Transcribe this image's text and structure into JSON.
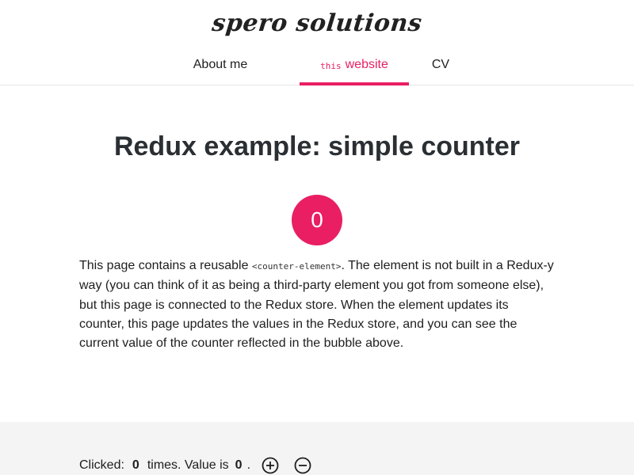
{
  "header": {
    "logo": "spero solutions",
    "nav": [
      {
        "label": "About me"
      },
      {
        "code": "this",
        "label": "website"
      },
      {
        "label": "CV"
      }
    ]
  },
  "colors": {
    "accent": "#e91e63",
    "section_bg": "#f4f4f4"
  },
  "main": {
    "title": "Redux example: simple counter",
    "bubble_value": "0",
    "description": {
      "before": "This page contains a reusable ",
      "code": "<counter-element>",
      "after": ". The element is not built in a Redux-y way (you can think of it as being a third-party element you got from someone else), but this page is connected to the Redux store. When the element updates its counter, this page updates the values in the Redux store, and you can see the current value of the counter reflected in the bubble above."
    }
  },
  "counter": {
    "clicked_label": "Clicked:",
    "clicks": "0",
    "times_label": "times. Value is",
    "value": "0",
    "period": ".",
    "increment_icon": "plus-circle-icon",
    "decrement_icon": "minus-circle-icon"
  }
}
